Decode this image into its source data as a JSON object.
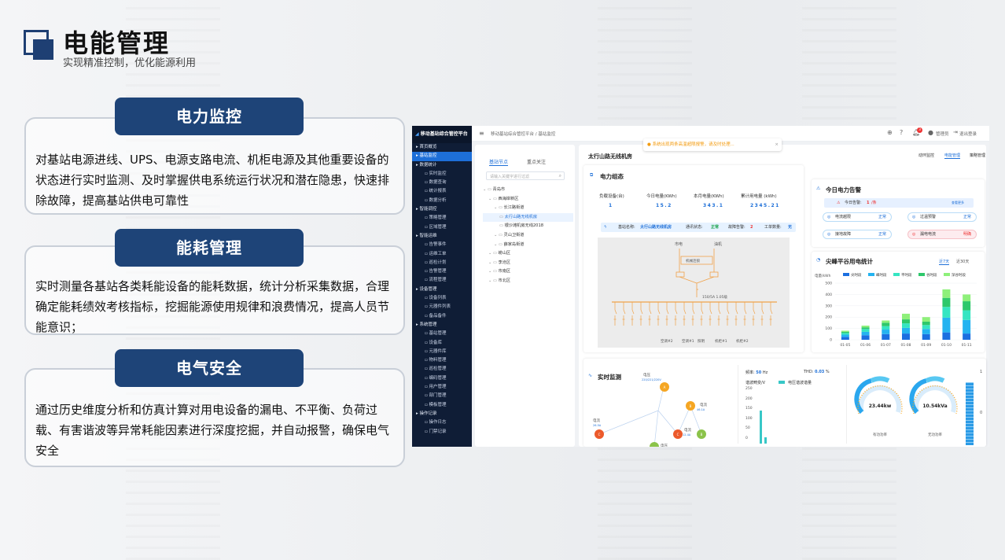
{
  "slide": {
    "title": "电能管理",
    "subtitle": "实现精准控制，优化能源利用"
  },
  "cards": [
    {
      "heading": "电力监控",
      "text": "对基站电源进线、UPS、电源支路电流、机柜电源及其他重要设备的状态进行实时监测、及时掌握供电系统运行状况和潜在隐患，快速排除故障，提高基站供电可靠性"
    },
    {
      "heading": "能耗管理",
      "text": "实时测量各基站各类耗能设备的能耗数据，统计分析采集数据，合理确定能耗绩效考核指标，挖掘能源使用规律和浪费情况，提高人员节能意识；"
    },
    {
      "heading": "电气安全",
      "text": "通过历史维度分析和仿真计算对用电设备的漏电、不平衡、负荷过载、有害谐波等异常耗能因素进行深度挖掘，并自动报警，确保电气安全"
    }
  ],
  "app": {
    "brand": "移动基站综合管控平台",
    "sidebar": [
      {
        "label": "首页概览",
        "level": 0
      },
      {
        "label": "基站监控",
        "level": 0,
        "active": true
      },
      {
        "label": "数据统计",
        "level": 0
      },
      {
        "label": "实时监控",
        "level": 1
      },
      {
        "label": "数据查询",
        "level": 1
      },
      {
        "label": "统计报表",
        "level": 1
      },
      {
        "label": "数据分析",
        "level": 1
      },
      {
        "label": "智能调控",
        "level": 0
      },
      {
        "label": "策略管理",
        "level": 1
      },
      {
        "label": "区域管理",
        "level": 1
      },
      {
        "label": "智能运维",
        "level": 0
      },
      {
        "label": "告警事件",
        "level": 1
      },
      {
        "label": "运维工单",
        "level": 1
      },
      {
        "label": "巡检计划",
        "level": 1
      },
      {
        "label": "告警管理",
        "level": 1
      },
      {
        "label": "流程管理",
        "level": 1
      },
      {
        "label": "设备管理",
        "level": 0
      },
      {
        "label": "设备列表",
        "level": 1
      },
      {
        "label": "元器件列表",
        "level": 1
      },
      {
        "label": "备品备件",
        "level": 1
      },
      {
        "label": "系统管理",
        "level": 0
      },
      {
        "label": "基站管理",
        "level": 1
      },
      {
        "label": "设备库",
        "level": 1
      },
      {
        "label": "元器件库",
        "level": 1
      },
      {
        "label": "物料管理",
        "level": 1
      },
      {
        "label": "巡检管理",
        "level": 1
      },
      {
        "label": "编码管理",
        "level": 1
      },
      {
        "label": "用户管理",
        "level": 1
      },
      {
        "label": "部门管理",
        "level": 1
      },
      {
        "label": "模板管理",
        "level": 1
      },
      {
        "label": "操作记录",
        "level": 0
      },
      {
        "label": "操作日志",
        "level": 1
      },
      {
        "label": "门禁记录",
        "level": 1
      }
    ],
    "breadcrumb": "移动基站综合管控平台 / 基站监控",
    "alert_msg": "系统出现两条高温超限报警，请及时处理...",
    "user": "管理员",
    "logout": "退出登录",
    "badge": "3",
    "tree_tabs": [
      "基站节点",
      "重点关注"
    ],
    "tree_search": "请输入关键字进行过滤",
    "tree": [
      {
        "label": "青岛市",
        "indent": 0
      },
      {
        "label": "西海岸新区",
        "indent": 1
      },
      {
        "label": "长江路街道",
        "indent": 2
      },
      {
        "label": "太行山路无线机房",
        "indent": 3,
        "selected": true
      },
      {
        "label": "银沙滩机房无线2018",
        "indent": 3
      },
      {
        "label": "灵山卫街道",
        "indent": 2
      },
      {
        "label": "薛家岛街道",
        "indent": 2
      },
      {
        "label": "崂山区",
        "indent": 1
      },
      {
        "label": "李沧区",
        "indent": 1
      },
      {
        "label": "市南区",
        "indent": 1
      },
      {
        "label": "市北区",
        "indent": 1
      }
    ],
    "room_title": "太行山路无线机房",
    "room_tabs": [
      "动环监控",
      "电能管理",
      "策略管理"
    ],
    "power_state": {
      "title": "电力组态",
      "metrics": [
        {
          "label": "负载设备(台)",
          "value": "1"
        },
        {
          "label": "今日电量(KWh)",
          "value": "15.2"
        },
        {
          "label": "本月电量(KWh)",
          "value": "343.1"
        },
        {
          "label": "累计用电量 (kWh)",
          "value": "2345.21"
        }
      ],
      "info": {
        "name_label": "基站名称:",
        "name": "太行山路无线机房",
        "comm_label": "通讯状态:",
        "comm": "正常",
        "fault_label": "故障告警:",
        "fault": "2",
        "work_label": "工单数量:",
        "work": "无"
      },
      "diagram": {
        "mains": "市电",
        "gen": "油机",
        "ats": "机械连锁",
        "breaker": "150/5A 1.05级",
        "loads": [
          "空调#2",
          "空调#1",
          "照明",
          "机柜#1",
          "机柜#2"
        ]
      }
    },
    "alarm": {
      "title": "今日电力告警",
      "today_label": "今日告警:",
      "today": "1",
      "unit": "/条",
      "history": "查看更多",
      "items": [
        {
          "label": "电流越限",
          "status": "正常"
        },
        {
          "label": "过温预警",
          "status": "正常"
        },
        {
          "label": "接地故障",
          "status": "正常"
        },
        {
          "label": "漏电电流",
          "status": "明确"
        }
      ]
    },
    "chart_title": "尖峰平谷用电统计",
    "chart_tabs": [
      "近7天",
      "近30天"
    ],
    "chart_data": {
      "type": "bar",
      "stacked": true,
      "categories": [
        "01-05",
        "01-06",
        "01-07",
        "01-08",
        "01-09",
        "01-10",
        "01-11"
      ],
      "series": [
        {
          "name": "尖时段",
          "color": "#1b6fe0",
          "values": [
            25,
            40,
            50,
            55,
            50,
            65,
            55
          ]
        },
        {
          "name": "峰时段",
          "color": "#24b3f0",
          "values": [
            20,
            30,
            40,
            50,
            45,
            130,
            120
          ]
        },
        {
          "name": "平时段",
          "color": "#35e5c2",
          "values": [
            15,
            25,
            30,
            40,
            35,
            95,
            85
          ]
        },
        {
          "name": "谷时段",
          "color": "#2ec86b",
          "values": [
            10,
            15,
            30,
            35,
            30,
            80,
            80
          ]
        },
        {
          "name": "深谷时段",
          "color": "#8ef07a",
          "values": [
            10,
            15,
            20,
            50,
            40,
            75,
            60
          ]
        }
      ],
      "ylabel": "电量/kWh",
      "ylim": [
        0,
        500
      ],
      "yticks": [
        0,
        100,
        200,
        300,
        400,
        500
      ]
    },
    "realtime": {
      "title": "实时监测",
      "freq_label": "频率:",
      "freq": "50",
      "freq_unit": "Hz",
      "thd_label": "THD:",
      "thd": "0.03",
      "thd_unit": "%",
      "nodes": [
        {
          "label": "电压",
          "value": "220/221/220V"
        },
        {
          "label": "电流",
          "value": "26.5A"
        },
        {
          "label": "电压",
          "value": "223V"
        },
        {
          "label": "电流",
          "value": "12.4A"
        },
        {
          "label": "电流",
          "value": "46.1A"
        }
      ],
      "harm_title": "谐波畸变/V",
      "harm_legend": "电压谐波谐量",
      "harm_ticks": [
        "250",
        "200",
        "150",
        "100",
        "50",
        "0"
      ],
      "gauges": [
        {
          "value": "23.44kw",
          "label": "有功功率"
        },
        {
          "value": "10.54kVa",
          "label": "无功功率"
        }
      ],
      "bar_ticks": [
        "1",
        "0"
      ]
    }
  }
}
